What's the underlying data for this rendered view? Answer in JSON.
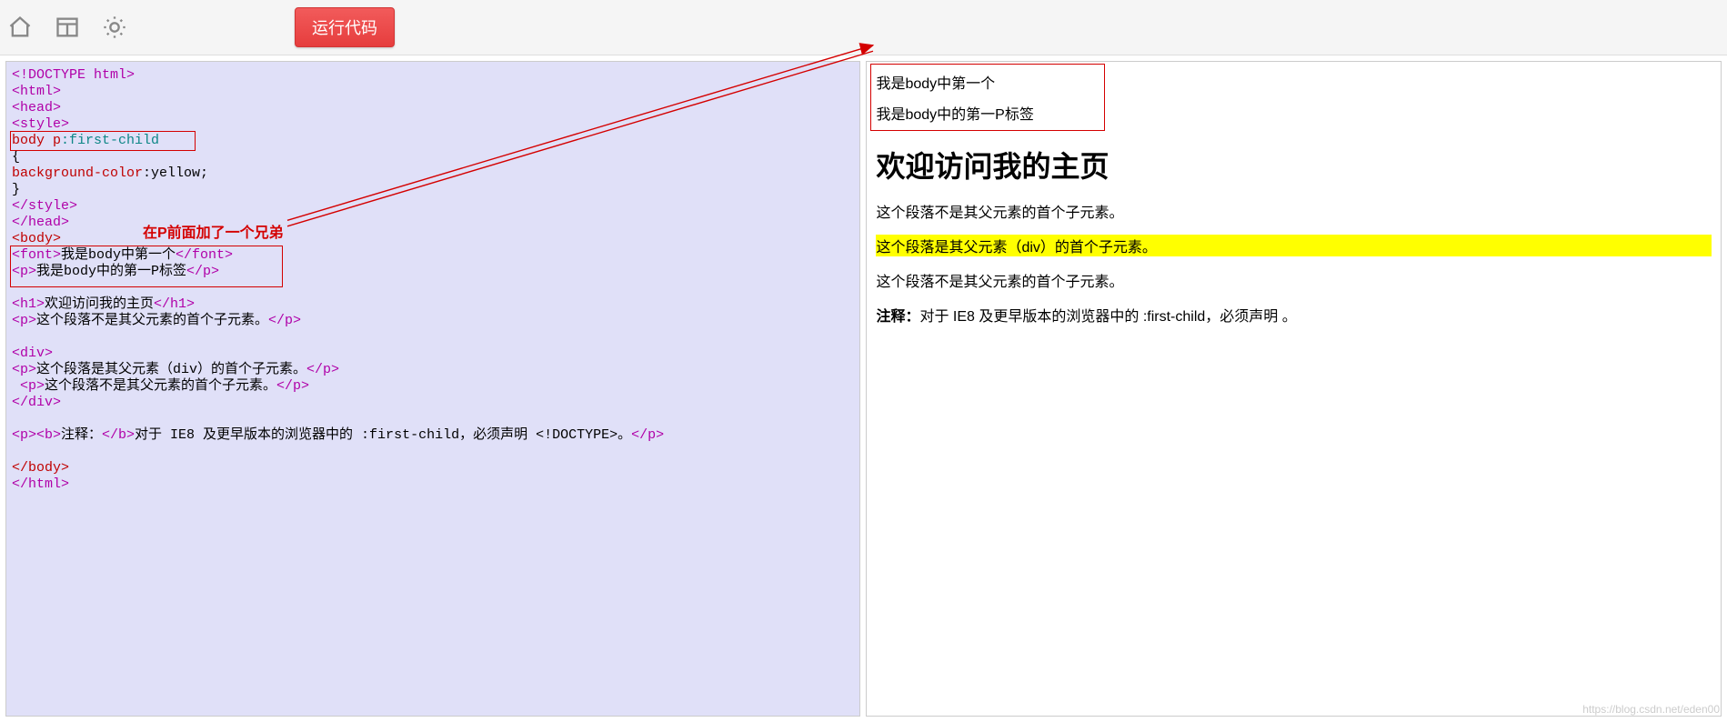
{
  "toolbar": {
    "run_label": "运行代码"
  },
  "code": {
    "l01": "<!DOCTYPE html>",
    "l02": "<html>",
    "l03": "<head>",
    "l04": "<style>",
    "selector": "body p",
    "pseudo": ":first-child",
    "l06": "{",
    "prop": "background-color",
    "colon_val": ":yellow;",
    "l08": "}",
    "l09": "</style>",
    "l10": "</head>",
    "l11": "<body>",
    "font_open": "<font>",
    "font_text": "我是body中第一个",
    "font_close": "</font>",
    "p1_open": "<p>",
    "p1_text": "我是body中的第一P标签",
    "p1_close": "</p>",
    "h1_open": "<h1>",
    "h1_text": "欢迎访问我的主页",
    "h1_close": "</h1>",
    "p2_open": "<p>",
    "p2_text": "这个段落不是其父元素的首个子元素。",
    "p2_close": "</p>",
    "div_open": "<div>",
    "p3_open": "<p>",
    "p3_text": "这个段落是其父元素（div）的首个子元素。",
    "p3_close": "</p>",
    "p4_open": " <p>",
    "p4_text": "这个段落不是其父元素的首个子元素。",
    "p4_close": "</p>",
    "div_close": "</div>",
    "p5_open": "<p><b>",
    "p5_b": "注释：",
    "p5_mid": "</b>",
    "p5_text": "对于 IE8 及更早版本的浏览器中的 :first-child，必须声明 <!DOCTYPE>。",
    "p5_close": "</p>",
    "l_end1": "</body>",
    "l_end2": "</html>"
  },
  "annotation": {
    "note": "在P前面加了一个兄弟"
  },
  "preview": {
    "line1": "我是body中第一个",
    "line2": "我是body中的第一P标签",
    "h1": "欢迎访问我的主页",
    "p_not1": "这个段落不是其父元素的首个子元素。",
    "p_is": "这个段落是其父元素（div）的首个子元素。",
    "p_not2": "这个段落不是其父元素的首个子元素。",
    "note_b": "注释：",
    "note_text": "对于 IE8 及更早版本的浏览器中的 :first-child，必须声明 。"
  },
  "watermark": "https://blog.csdn.net/eden00"
}
